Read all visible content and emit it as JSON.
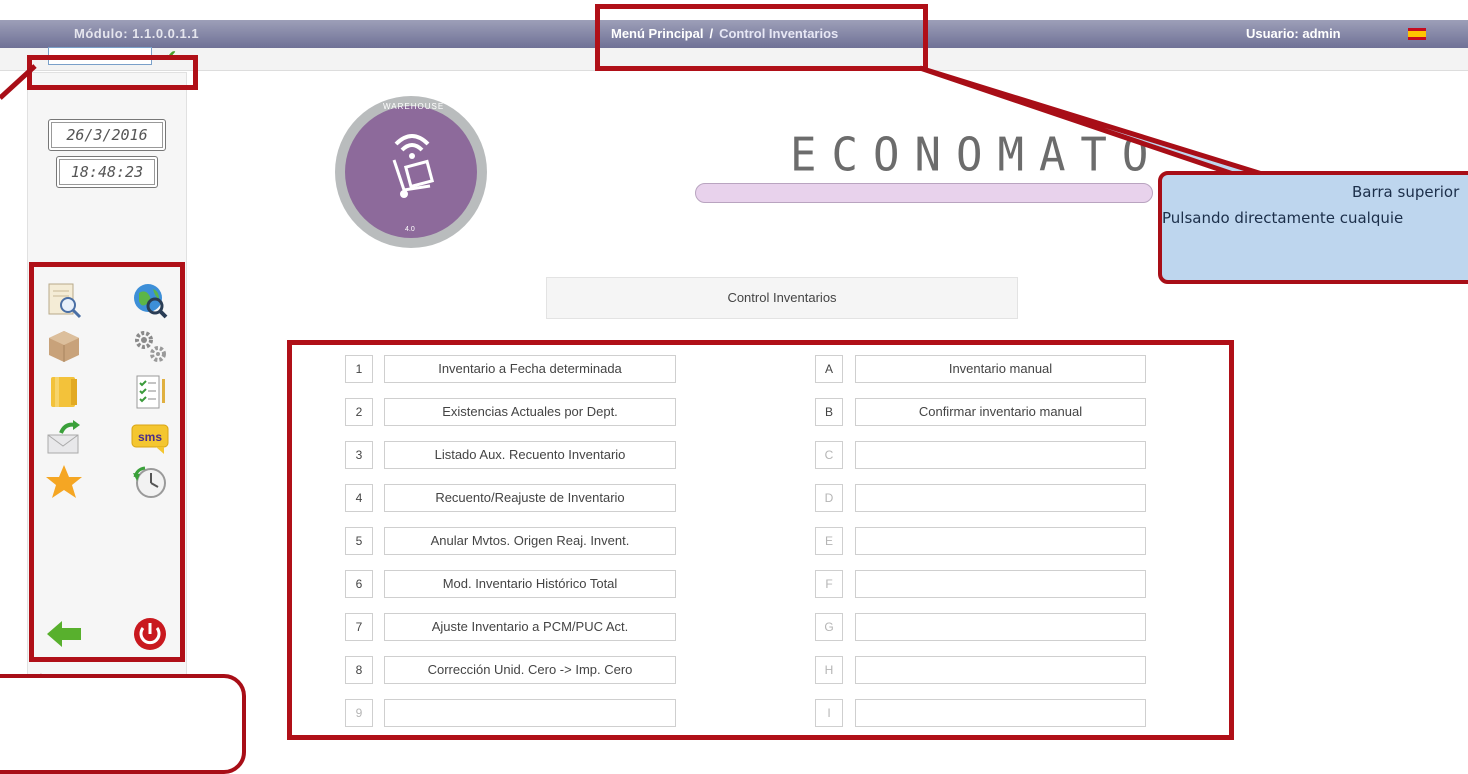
{
  "topbar": {
    "module": "Módulo: 1.1.0.0.1.1",
    "breadcrumb": {
      "root": "Menú Principal",
      "separator": "/",
      "current": "Control Inventarios"
    },
    "user": "Usuario: admin",
    "flag_icon": "spain-flag-icon"
  },
  "quick_code": {
    "value": "",
    "placeholder": "",
    "confirm_icon": "checkmark-icon"
  },
  "sidebar": {
    "date": "26/3/2016",
    "time": "18:48:23",
    "icons": [
      "document-search-icon",
      "globe-search-icon",
      "package-box-icon",
      "gears-icon",
      "folder-icon",
      "checklist-icon",
      "mail-send-icon",
      "sms-icon",
      "favorite-star-icon",
      "history-clock-icon",
      "back-arrow-icon",
      "power-off-icon"
    ],
    "sms_label": "sms"
  },
  "brand": {
    "name": "ECONOMATO",
    "logo_top": "WAREHOUSE",
    "logo_version": "4.0"
  },
  "section_title": "Control Inventarios",
  "menu": {
    "left": [
      {
        "key": "1",
        "label": "Inventario a Fecha determinada"
      },
      {
        "key": "2",
        "label": "Existencias Actuales por Dept."
      },
      {
        "key": "3",
        "label": "Listado Aux. Recuento Inventario"
      },
      {
        "key": "4",
        "label": "Recuento/Reajuste de Inventario"
      },
      {
        "key": "5",
        "label": "Anular Mvtos. Origen Reaj. Invent."
      },
      {
        "key": "6",
        "label": "Mod. Inventario Histórico Total"
      },
      {
        "key": "7",
        "label": "Ajuste Inventario a PCM/PUC Act."
      },
      {
        "key": "8",
        "label": "Corrección Unid. Cero -> Imp. Cero"
      },
      {
        "key": "9",
        "label": ""
      }
    ],
    "right": [
      {
        "key": "A",
        "label": "Inventario manual"
      },
      {
        "key": "B",
        "label": "Confirmar inventario manual"
      },
      {
        "key": "C",
        "label": ""
      },
      {
        "key": "D",
        "label": ""
      },
      {
        "key": "E",
        "label": ""
      },
      {
        "key": "F",
        "label": ""
      },
      {
        "key": "G",
        "label": ""
      },
      {
        "key": "H",
        "label": ""
      },
      {
        "key": "I",
        "label": ""
      }
    ]
  },
  "callout": {
    "line1": "Barra superior",
    "line2": "Pulsando directamente cualquie"
  },
  "colors": {
    "annotation_red": "#b01018",
    "callout_blue": "#bed6ee",
    "topbar": "#7f81a3",
    "brand_purple": "#8d6a9b"
  }
}
